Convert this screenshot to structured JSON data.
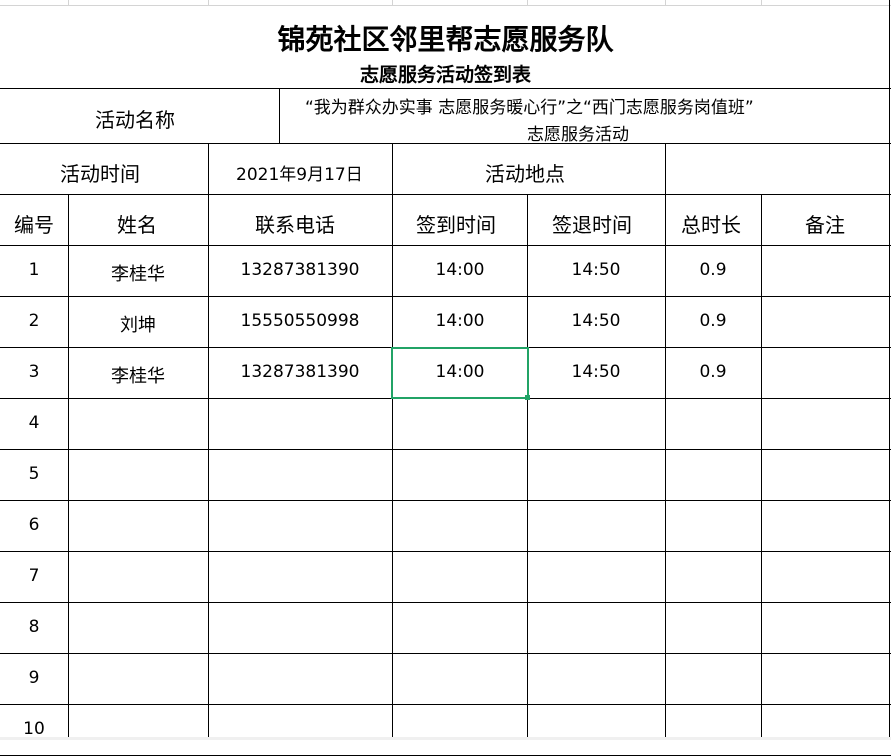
{
  "sheet": {
    "title": "锦苑社区邻里帮志愿服务队",
    "subtitle": "志愿服务活动签到表",
    "activity_name_label": "活动名称",
    "activity_name_value_line1": "“我为群众办实事 志愿服务暖心行”之“西门志愿服务岗值班”",
    "activity_name_value_line2": "志愿服务活动",
    "activity_time_label": "活动时间",
    "activity_time_value": "2021年9月17日",
    "activity_place_label": "活动地点",
    "activity_place_value": "",
    "headers": [
      "编号",
      "姓名",
      "联系电话",
      "签到时间",
      "签退时间",
      "总时长",
      "备注"
    ],
    "rows": [
      {
        "no": "1",
        "name": "李桂华",
        "phone": "13287381390",
        "in": "14:00",
        "out": "14:50",
        "hours": "0.9",
        "note": ""
      },
      {
        "no": "2",
        "name": "刘坤",
        "phone": "15550550998",
        "in": "14:00",
        "out": "14:50",
        "hours": "0.9",
        "note": ""
      },
      {
        "no": "3",
        "name": "李桂华",
        "phone": "13287381390",
        "in": "14:00",
        "out": "14:50",
        "hours": "0.9",
        "note": ""
      },
      {
        "no": "4",
        "name": "",
        "phone": "",
        "in": "",
        "out": "",
        "hours": "",
        "note": ""
      },
      {
        "no": "5",
        "name": "",
        "phone": "",
        "in": "",
        "out": "",
        "hours": "",
        "note": ""
      },
      {
        "no": "6",
        "name": "",
        "phone": "",
        "in": "",
        "out": "",
        "hours": "",
        "note": ""
      },
      {
        "no": "7",
        "name": "",
        "phone": "",
        "in": "",
        "out": "",
        "hours": "",
        "note": ""
      },
      {
        "no": "8",
        "name": "",
        "phone": "",
        "in": "",
        "out": "",
        "hours": "",
        "note": ""
      },
      {
        "no": "9",
        "name": "",
        "phone": "",
        "in": "",
        "out": "",
        "hours": "",
        "note": ""
      },
      {
        "no": "10",
        "name": "",
        "phone": "",
        "in": "",
        "out": "",
        "hours": "",
        "note": ""
      }
    ]
  },
  "colors": {
    "selection": "#21a366",
    "gridline": "#d4d4d4",
    "border": "#000000"
  }
}
